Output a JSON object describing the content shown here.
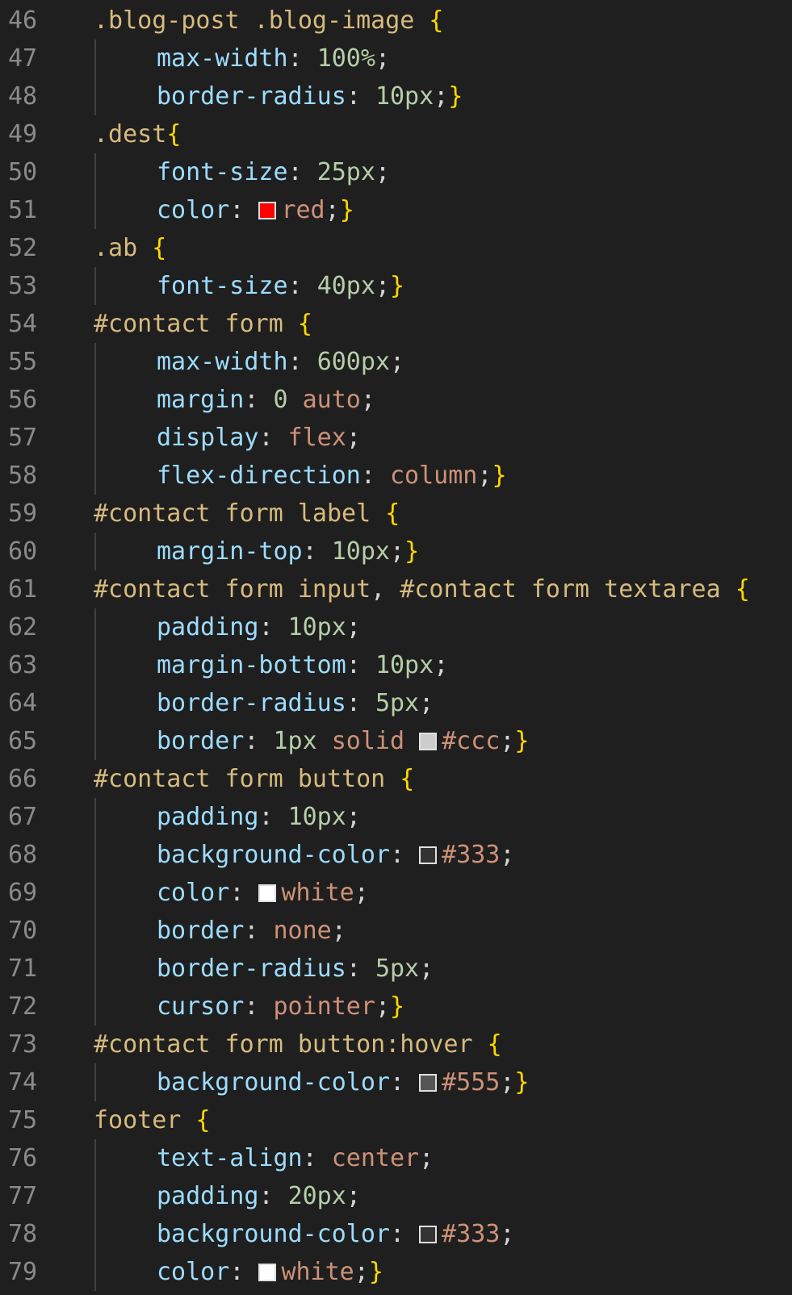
{
  "editor": {
    "language": "css",
    "colors": {
      "background": "#1f1f1f",
      "line_number": "#8a8a8a",
      "selector": "#d7ba7d",
      "property": "#9cdcfe",
      "number": "#b5cea8",
      "keyword": "#ce9178",
      "punctuation": "#d4d4d4",
      "bracket": "#ffd700"
    },
    "lines": [
      {
        "n": "46",
        "indent": 0,
        "tokens": [
          {
            "t": ".blog-post .blog-image ",
            "c": "sel"
          },
          {
            "t": "{",
            "c": "br"
          }
        ]
      },
      {
        "n": "47",
        "indent": 1,
        "tokens": [
          {
            "t": "max-width",
            "c": "prop"
          },
          {
            "t": ": ",
            "c": "pun"
          },
          {
            "t": "100%",
            "c": "num"
          },
          {
            "t": ";",
            "c": "pun"
          }
        ]
      },
      {
        "n": "48",
        "indent": 1,
        "tokens": [
          {
            "t": "border-radius",
            "c": "prop"
          },
          {
            "t": ": ",
            "c": "pun"
          },
          {
            "t": "10px",
            "c": "num"
          },
          {
            "t": ";",
            "c": "pun"
          },
          {
            "t": "}",
            "c": "br"
          }
        ]
      },
      {
        "n": "49",
        "indent": 0,
        "tokens": [
          {
            "t": ".dest",
            "c": "sel"
          },
          {
            "t": "{",
            "c": "br"
          }
        ]
      },
      {
        "n": "50",
        "indent": 1,
        "tokens": [
          {
            "t": "font-size",
            "c": "prop"
          },
          {
            "t": ": ",
            "c": "pun"
          },
          {
            "t": "25px",
            "c": "num"
          },
          {
            "t": ";",
            "c": "pun"
          }
        ]
      },
      {
        "n": "51",
        "indent": 1,
        "tokens": [
          {
            "t": "color",
            "c": "prop"
          },
          {
            "t": ": ",
            "c": "pun"
          },
          {
            "swatch": "#ff0000"
          },
          {
            "t": "red",
            "c": "kw"
          },
          {
            "t": ";",
            "c": "pun"
          },
          {
            "t": "}",
            "c": "br"
          }
        ]
      },
      {
        "n": "52",
        "indent": 0,
        "tokens": [
          {
            "t": ".ab ",
            "c": "sel"
          },
          {
            "t": "{",
            "c": "br"
          }
        ]
      },
      {
        "n": "53",
        "indent": 1,
        "tokens": [
          {
            "t": "font-size",
            "c": "prop"
          },
          {
            "t": ": ",
            "c": "pun"
          },
          {
            "t": "40px",
            "c": "num"
          },
          {
            "t": ";",
            "c": "pun"
          },
          {
            "t": "}",
            "c": "br"
          }
        ]
      },
      {
        "n": "54",
        "indent": 0,
        "tokens": [
          {
            "t": "#contact form ",
            "c": "sel"
          },
          {
            "t": "{",
            "c": "br"
          }
        ]
      },
      {
        "n": "55",
        "indent": 1,
        "tokens": [
          {
            "t": "max-width",
            "c": "prop"
          },
          {
            "t": ": ",
            "c": "pun"
          },
          {
            "t": "600px",
            "c": "num"
          },
          {
            "t": ";",
            "c": "pun"
          }
        ]
      },
      {
        "n": "56",
        "indent": 1,
        "tokens": [
          {
            "t": "margin",
            "c": "prop"
          },
          {
            "t": ": ",
            "c": "pun"
          },
          {
            "t": "0",
            "c": "num"
          },
          {
            "t": " ",
            "c": "pun"
          },
          {
            "t": "auto",
            "c": "kw"
          },
          {
            "t": ";",
            "c": "pun"
          }
        ]
      },
      {
        "n": "57",
        "indent": 1,
        "tokens": [
          {
            "t": "display",
            "c": "prop"
          },
          {
            "t": ": ",
            "c": "pun"
          },
          {
            "t": "flex",
            "c": "kw"
          },
          {
            "t": ";",
            "c": "pun"
          }
        ]
      },
      {
        "n": "58",
        "indent": 1,
        "tokens": [
          {
            "t": "flex-direction",
            "c": "prop"
          },
          {
            "t": ": ",
            "c": "pun"
          },
          {
            "t": "column",
            "c": "kw"
          },
          {
            "t": ";",
            "c": "pun"
          },
          {
            "t": "}",
            "c": "br"
          }
        ]
      },
      {
        "n": "59",
        "indent": 0,
        "tokens": [
          {
            "t": "#contact form label ",
            "c": "sel"
          },
          {
            "t": "{",
            "c": "br"
          }
        ]
      },
      {
        "n": "60",
        "indent": 1,
        "tokens": [
          {
            "t": "margin-top",
            "c": "prop"
          },
          {
            "t": ": ",
            "c": "pun"
          },
          {
            "t": "10px",
            "c": "num"
          },
          {
            "t": ";",
            "c": "pun"
          },
          {
            "t": "}",
            "c": "br"
          }
        ]
      },
      {
        "n": "61",
        "indent": 0,
        "tokens": [
          {
            "t": "#contact form input",
            "c": "sel"
          },
          {
            "t": ", ",
            "c": "pun"
          },
          {
            "t": "#contact form textarea ",
            "c": "sel"
          },
          {
            "t": "{",
            "c": "br"
          }
        ]
      },
      {
        "n": "62",
        "indent": 1,
        "tokens": [
          {
            "t": "padding",
            "c": "prop"
          },
          {
            "t": ": ",
            "c": "pun"
          },
          {
            "t": "10px",
            "c": "num"
          },
          {
            "t": ";",
            "c": "pun"
          }
        ]
      },
      {
        "n": "63",
        "indent": 1,
        "tokens": [
          {
            "t": "margin-bottom",
            "c": "prop"
          },
          {
            "t": ": ",
            "c": "pun"
          },
          {
            "t": "10px",
            "c": "num"
          },
          {
            "t": ";",
            "c": "pun"
          }
        ]
      },
      {
        "n": "64",
        "indent": 1,
        "tokens": [
          {
            "t": "border-radius",
            "c": "prop"
          },
          {
            "t": ": ",
            "c": "pun"
          },
          {
            "t": "5px",
            "c": "num"
          },
          {
            "t": ";",
            "c": "pun"
          }
        ]
      },
      {
        "n": "65",
        "indent": 1,
        "tokens": [
          {
            "t": "border",
            "c": "prop"
          },
          {
            "t": ": ",
            "c": "pun"
          },
          {
            "t": "1px",
            "c": "num"
          },
          {
            "t": " ",
            "c": "pun"
          },
          {
            "t": "solid",
            "c": "kw"
          },
          {
            "t": " ",
            "c": "pun"
          },
          {
            "swatch": "#cccccc"
          },
          {
            "t": "#ccc",
            "c": "kw"
          },
          {
            "t": ";",
            "c": "pun"
          },
          {
            "t": "}",
            "c": "br"
          }
        ]
      },
      {
        "n": "66",
        "indent": 0,
        "tokens": [
          {
            "t": "#contact form button ",
            "c": "sel"
          },
          {
            "t": "{",
            "c": "br"
          }
        ]
      },
      {
        "n": "67",
        "indent": 1,
        "tokens": [
          {
            "t": "padding",
            "c": "prop"
          },
          {
            "t": ": ",
            "c": "pun"
          },
          {
            "t": "10px",
            "c": "num"
          },
          {
            "t": ";",
            "c": "pun"
          }
        ]
      },
      {
        "n": "68",
        "indent": 1,
        "tokens": [
          {
            "t": "background-color",
            "c": "prop"
          },
          {
            "t": ": ",
            "c": "pun"
          },
          {
            "swatch": "#333333"
          },
          {
            "t": "#333",
            "c": "kw"
          },
          {
            "t": ";",
            "c": "pun"
          }
        ]
      },
      {
        "n": "69",
        "indent": 1,
        "tokens": [
          {
            "t": "color",
            "c": "prop"
          },
          {
            "t": ": ",
            "c": "pun"
          },
          {
            "swatch": "#ffffff"
          },
          {
            "t": "white",
            "c": "kw"
          },
          {
            "t": ";",
            "c": "pun"
          }
        ]
      },
      {
        "n": "70",
        "indent": 1,
        "tokens": [
          {
            "t": "border",
            "c": "prop"
          },
          {
            "t": ": ",
            "c": "pun"
          },
          {
            "t": "none",
            "c": "kw"
          },
          {
            "t": ";",
            "c": "pun"
          }
        ]
      },
      {
        "n": "71",
        "indent": 1,
        "tokens": [
          {
            "t": "border-radius",
            "c": "prop"
          },
          {
            "t": ": ",
            "c": "pun"
          },
          {
            "t": "5px",
            "c": "num"
          },
          {
            "t": ";",
            "c": "pun"
          }
        ]
      },
      {
        "n": "72",
        "indent": 1,
        "tokens": [
          {
            "t": "cursor",
            "c": "prop"
          },
          {
            "t": ": ",
            "c": "pun"
          },
          {
            "t": "pointer",
            "c": "kw"
          },
          {
            "t": ";",
            "c": "pun"
          },
          {
            "t": "}",
            "c": "br"
          }
        ]
      },
      {
        "n": "73",
        "indent": 0,
        "tokens": [
          {
            "t": "#contact form button:hover ",
            "c": "sel"
          },
          {
            "t": "{",
            "c": "br"
          }
        ]
      },
      {
        "n": "74",
        "indent": 1,
        "tokens": [
          {
            "t": "background-color",
            "c": "prop"
          },
          {
            "t": ": ",
            "c": "pun"
          },
          {
            "swatch": "#555555"
          },
          {
            "t": "#555",
            "c": "kw"
          },
          {
            "t": ";",
            "c": "pun"
          },
          {
            "t": "}",
            "c": "br"
          }
        ]
      },
      {
        "n": "75",
        "indent": 0,
        "tokens": [
          {
            "t": "footer ",
            "c": "sel"
          },
          {
            "t": "{",
            "c": "br"
          }
        ]
      },
      {
        "n": "76",
        "indent": 1,
        "tokens": [
          {
            "t": "text-align",
            "c": "prop"
          },
          {
            "t": ": ",
            "c": "pun"
          },
          {
            "t": "center",
            "c": "kw"
          },
          {
            "t": ";",
            "c": "pun"
          }
        ]
      },
      {
        "n": "77",
        "indent": 1,
        "tokens": [
          {
            "t": "padding",
            "c": "prop"
          },
          {
            "t": ": ",
            "c": "pun"
          },
          {
            "t": "20px",
            "c": "num"
          },
          {
            "t": ";",
            "c": "pun"
          }
        ]
      },
      {
        "n": "78",
        "indent": 1,
        "tokens": [
          {
            "t": "background-color",
            "c": "prop"
          },
          {
            "t": ": ",
            "c": "pun"
          },
          {
            "swatch": "#333333"
          },
          {
            "t": "#333",
            "c": "kw"
          },
          {
            "t": ";",
            "c": "pun"
          }
        ]
      },
      {
        "n": "79",
        "indent": 1,
        "tokens": [
          {
            "t": "color",
            "c": "prop"
          },
          {
            "t": ": ",
            "c": "pun"
          },
          {
            "swatch": "#ffffff"
          },
          {
            "t": "white",
            "c": "kw"
          },
          {
            "t": ";",
            "c": "pun"
          },
          {
            "t": "}",
            "c": "br"
          }
        ]
      }
    ]
  }
}
